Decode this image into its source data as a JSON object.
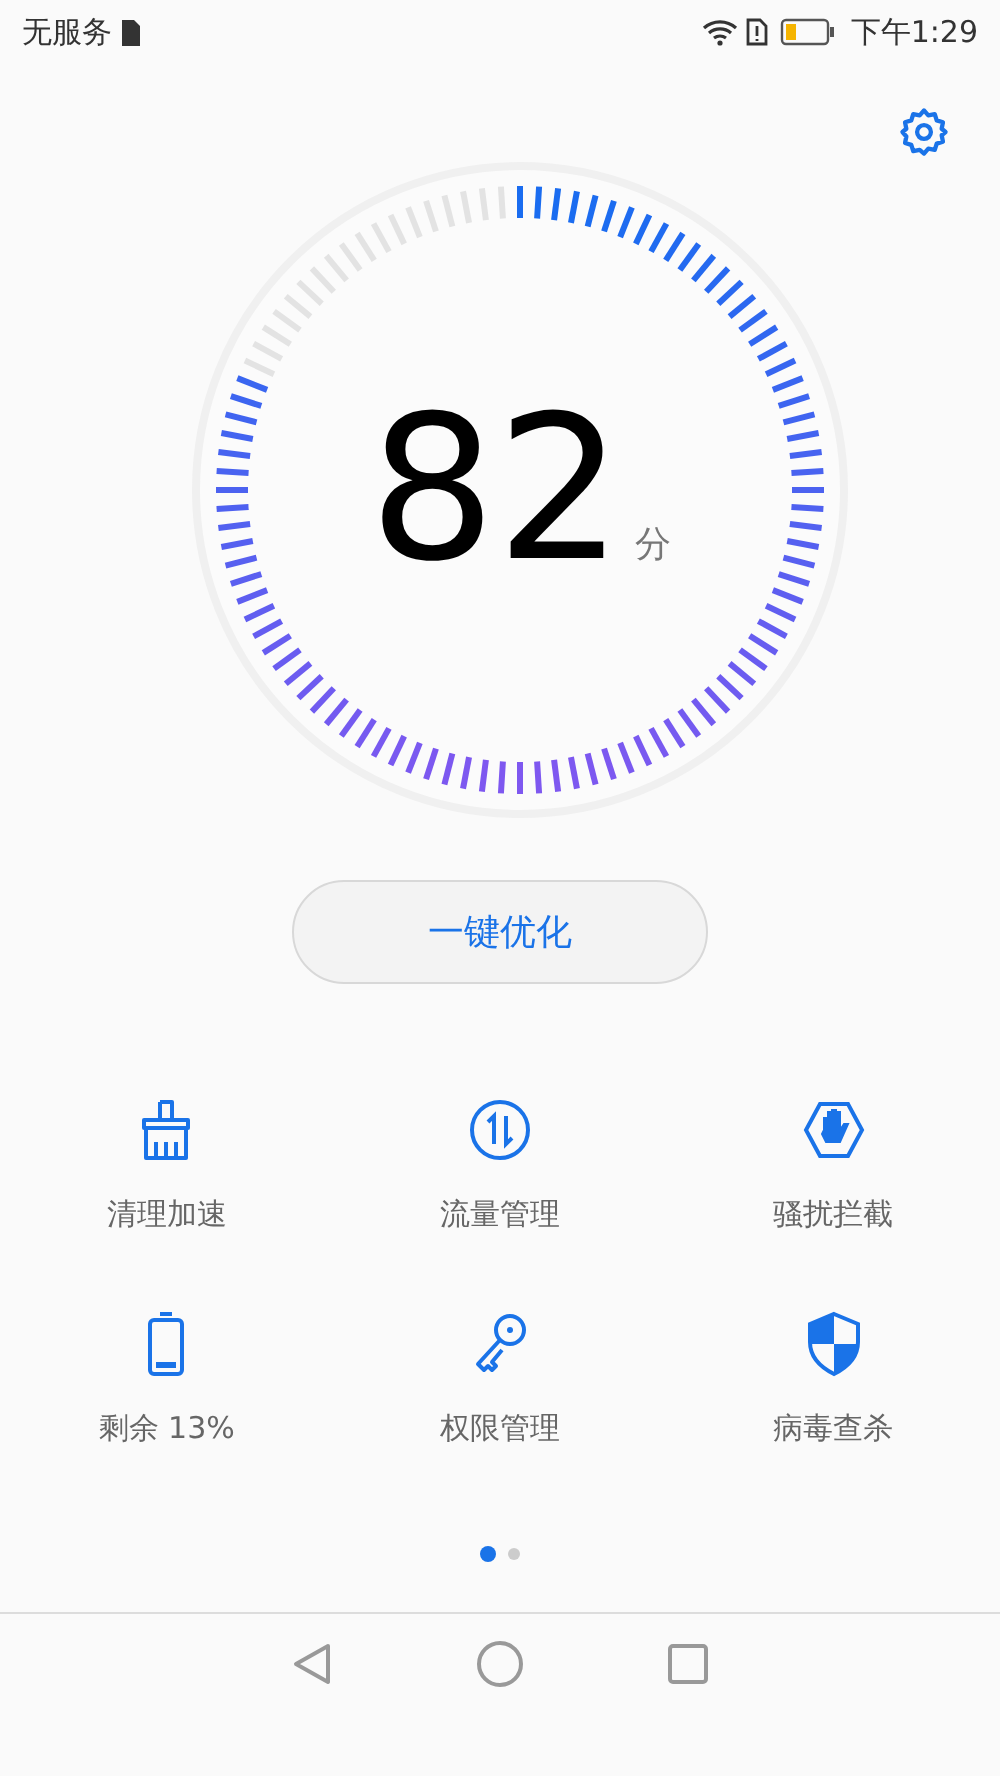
{
  "status_bar": {
    "carrier": "无服务",
    "time": "下午1:29"
  },
  "gauge": {
    "score": "82",
    "unit": "分"
  },
  "optimize_button": "一键优化",
  "tools": [
    {
      "kind": "broom",
      "label": "清理加速"
    },
    {
      "kind": "data",
      "label": "流量管理"
    },
    {
      "kind": "block",
      "label": "骚扰拦截"
    },
    {
      "kind": "battery",
      "label": "剩余 13%"
    },
    {
      "kind": "key",
      "label": "权限管理"
    },
    {
      "kind": "shield",
      "label": "病毒查杀"
    }
  ],
  "pages": [
    {
      "selected": true
    },
    {
      "selected": false
    }
  ]
}
